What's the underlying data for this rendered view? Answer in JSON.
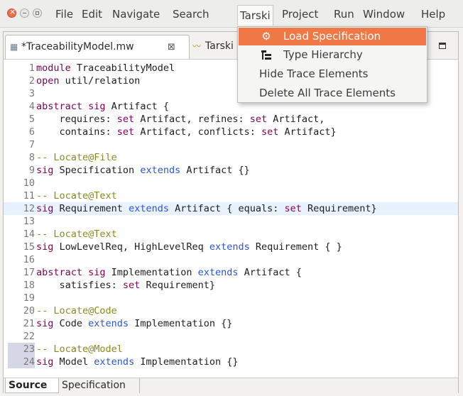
{
  "menubar": {
    "items": [
      "File",
      "Edit",
      "Navigate",
      "Search",
      "Tarski",
      "Project",
      "Run",
      "Window",
      "Help"
    ],
    "active": "Tarski"
  },
  "tabs": [
    {
      "label": "*TraceabilityModel.mw",
      "icon": "model-file-icon",
      "close": "⊠"
    },
    {
      "label": "Tarski",
      "icon": "tarski-view-icon"
    }
  ],
  "dropdown": {
    "items": [
      {
        "label": "Load Specification",
        "icon": "gear-icon",
        "highlighted": true
      },
      {
        "label": "Type Hierarchy",
        "icon": "hierarchy-icon",
        "highlighted": false
      },
      {
        "label": "Hide Trace Elements",
        "icon": "",
        "highlighted": false
      },
      {
        "label": "Delete All Trace Elements",
        "icon": "",
        "highlighted": false
      }
    ],
    "highlight_color": "#f07746"
  },
  "code": {
    "lines": [
      {
        "n": "1",
        "segments": [
          {
            "t": "module",
            "c": "kw"
          },
          {
            "t": " TraceabilityModel",
            "c": ""
          }
        ]
      },
      {
        "n": "2",
        "segments": [
          {
            "t": "open",
            "c": "kw"
          },
          {
            "t": " util/relation",
            "c": ""
          }
        ]
      },
      {
        "n": "3",
        "segments": []
      },
      {
        "n": "4",
        "segments": [
          {
            "t": "abstract sig",
            "c": "kw"
          },
          {
            "t": " Artifact {",
            "c": ""
          }
        ]
      },
      {
        "n": "5",
        "segments": [
          {
            "t": "    requires: ",
            "c": ""
          },
          {
            "t": "set",
            "c": "kw"
          },
          {
            "t": " Artifact, refines: ",
            "c": ""
          },
          {
            "t": "set",
            "c": "kw"
          },
          {
            "t": " Artifact,",
            "c": ""
          }
        ]
      },
      {
        "n": "6",
        "segments": [
          {
            "t": "    contains: ",
            "c": ""
          },
          {
            "t": "set",
            "c": "kw"
          },
          {
            "t": " Artifact, conflicts: ",
            "c": ""
          },
          {
            "t": "set",
            "c": "kw"
          },
          {
            "t": " Artifact}",
            "c": ""
          }
        ]
      },
      {
        "n": "7",
        "segments": []
      },
      {
        "n": "8",
        "segments": [
          {
            "t": "-- Locate@File",
            "c": "cm"
          }
        ]
      },
      {
        "n": "9",
        "segments": [
          {
            "t": "sig",
            "c": "kw"
          },
          {
            "t": " Specification ",
            "c": ""
          },
          {
            "t": "extends",
            "c": "kw2"
          },
          {
            "t": " Artifact {}",
            "c": ""
          }
        ]
      },
      {
        "n": "10",
        "segments": []
      },
      {
        "n": "11",
        "segments": [
          {
            "t": "-- Locate@Text",
            "c": "cm"
          }
        ]
      },
      {
        "n": "12",
        "segments": [
          {
            "t": "sig",
            "c": "kw"
          },
          {
            "t": " Requirement ",
            "c": ""
          },
          {
            "t": "extends",
            "c": "kw2"
          },
          {
            "t": " Artifact { equals: ",
            "c": ""
          },
          {
            "t": "set",
            "c": "kw"
          },
          {
            "t": " Requirement}",
            "c": ""
          }
        ],
        "highlight": true
      },
      {
        "n": "13",
        "segments": []
      },
      {
        "n": "14",
        "segments": [
          {
            "t": "-- Locate@Text",
            "c": "cm"
          }
        ]
      },
      {
        "n": "15",
        "segments": [
          {
            "t": "sig",
            "c": "kw"
          },
          {
            "t": " LowLevelReq, HighLevelReq ",
            "c": ""
          },
          {
            "t": "extends",
            "c": "kw2"
          },
          {
            "t": " Requirement { }",
            "c": ""
          }
        ]
      },
      {
        "n": "16",
        "segments": []
      },
      {
        "n": "17",
        "segments": [
          {
            "t": "abstract sig",
            "c": "kw"
          },
          {
            "t": " Implementation ",
            "c": ""
          },
          {
            "t": "extends",
            "c": "kw2"
          },
          {
            "t": " Artifact {",
            "c": ""
          }
        ]
      },
      {
        "n": "18",
        "segments": [
          {
            "t": "    satisfies: ",
            "c": ""
          },
          {
            "t": "set",
            "c": "kw"
          },
          {
            "t": " Requirement}",
            "c": ""
          }
        ]
      },
      {
        "n": "19",
        "segments": []
      },
      {
        "n": "20",
        "segments": [
          {
            "t": "-- Locate@Code",
            "c": "cm"
          }
        ]
      },
      {
        "n": "21",
        "segments": [
          {
            "t": "sig",
            "c": "kw"
          },
          {
            "t": " Code ",
            "c": ""
          },
          {
            "t": "extends",
            "c": "kw2"
          },
          {
            "t": " Implementation {}",
            "c": ""
          }
        ]
      },
      {
        "n": "22",
        "segments": []
      },
      {
        "n": "23",
        "segments": [
          {
            "t": "-- Locate@Model",
            "c": "cm"
          }
        ],
        "ln_selected": true
      },
      {
        "n": "24",
        "segments": [
          {
            "t": "sig",
            "c": "kw"
          },
          {
            "t": " Model ",
            "c": ""
          },
          {
            "t": "extends",
            "c": "kw2"
          },
          {
            "t": " Implementation {}",
            "c": ""
          }
        ],
        "ln_selected": true
      }
    ]
  },
  "bottom_tabs": [
    "Source",
    "Specification"
  ],
  "colors": {
    "keyword": "#7f0055",
    "extends_keyword": "#2a55d4",
    "comment": "#8a8a1e",
    "line_highlight": "#e8f2fe"
  }
}
